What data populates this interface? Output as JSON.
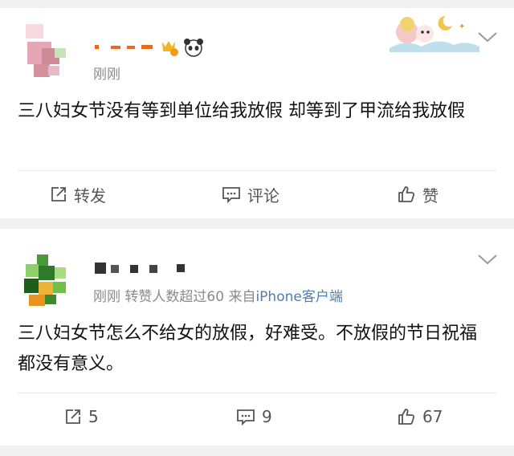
{
  "posts": [
    {
      "time": "刚刚",
      "meta_extra": "",
      "source": "",
      "text": "三八妇女节没有等到单位给我放假 却等到了甲流给我放假",
      "actions": {
        "repost": "转发",
        "comment": "评论",
        "like": "赞"
      }
    },
    {
      "time": "刚刚",
      "meta_extra": "转赞人数超过60 来自",
      "source": "iPhone客户端",
      "text": "三八妇女节怎么不给女的放假，好难受。不放假的节日祝福都没有意义。",
      "actions": {
        "repost": "5",
        "comment": "9",
        "like": "67"
      }
    }
  ],
  "colors": {
    "background": "#f1f1f1",
    "card": "#ffffff",
    "link": "#507daf",
    "meta": "#8b8b8b"
  },
  "icons": [
    "repost-icon",
    "comment-icon",
    "like-icon",
    "chevron-down-icon",
    "crown-badge-icon",
    "panda-icon"
  ]
}
